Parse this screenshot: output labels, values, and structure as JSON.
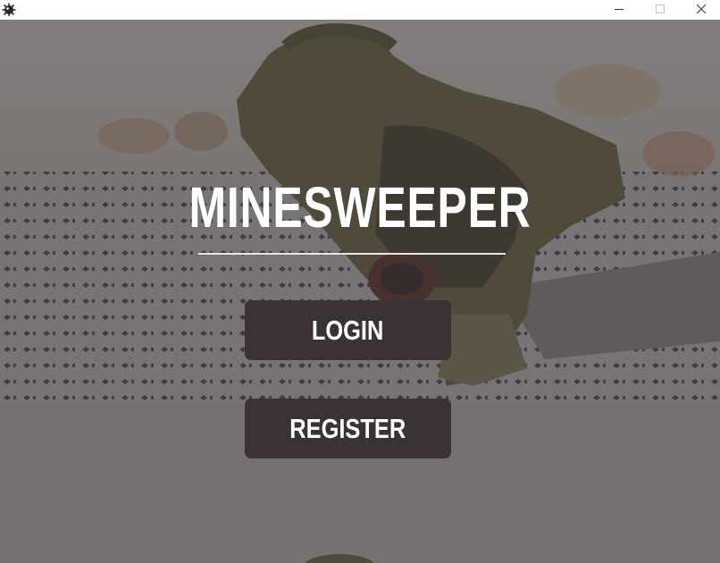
{
  "window": {
    "app_icon": "mine-icon",
    "controls": {
      "minimize_icon": "minimize-icon",
      "maximize_icon": "maximize-icon",
      "close_icon": "close-icon"
    }
  },
  "main": {
    "title": "MINESWEEPER",
    "login_label": "LOGIN",
    "register_label": "REGISTER"
  },
  "colors": {
    "button_bg": "#3a3233",
    "overlay": "#3c3738",
    "title_text": "#ffffff"
  }
}
